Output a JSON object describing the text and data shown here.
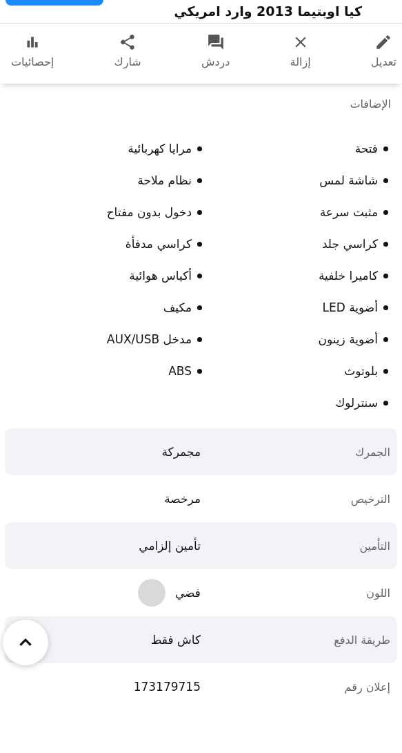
{
  "header": {
    "title": "كيا اوبتيما 2013 وارد امريكي"
  },
  "actions": [
    {
      "kind": "edit",
      "label": "تعديل"
    },
    {
      "kind": "remove",
      "label": "إزالة"
    },
    {
      "kind": "chat",
      "label": "دردش"
    },
    {
      "kind": "share",
      "label": "شارك"
    },
    {
      "kind": "stats",
      "label": "إحصائيات"
    }
  ],
  "features": {
    "title": "الإضافات",
    "columns": [
      [
        "فتحة",
        "شاشة لمس",
        "مثبت سرعة",
        "كراسي جلد",
        "كاميرا خلفية",
        "أضوية LED",
        "أضوية زينون",
        "بلوتوث",
        "سنترلوك"
      ],
      [
        "مرايا كهربائية",
        "نظام ملاحة",
        "دخول بدون مفتاح",
        "كراسي مدفأة",
        "أكياس هوائية",
        "مكيف",
        "مدخل AUX/USB",
        "ABS"
      ]
    ]
  },
  "details": [
    {
      "label": "الجمرك",
      "value": "مجمركة"
    },
    {
      "label": "الترخيص",
      "value": "مرخصة"
    },
    {
      "label": "التأمين",
      "value": "تأمين إلزامي"
    },
    {
      "label": "اللون",
      "value": "فضي",
      "color": "#d9d9d9"
    },
    {
      "label": "طريقة الدفع",
      "value": "كاش فقط"
    },
    {
      "label": "إعلان رقم",
      "value": "173179715"
    }
  ]
}
